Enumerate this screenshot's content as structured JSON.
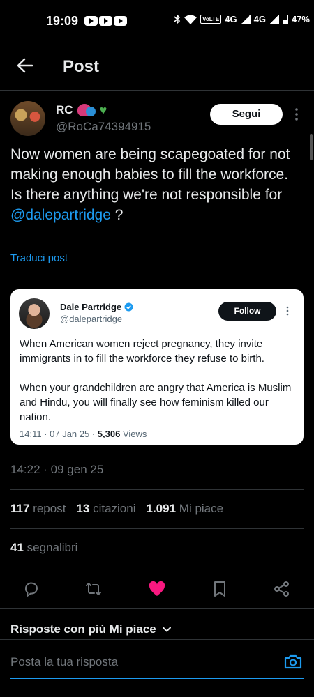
{
  "status_bar": {
    "time": "19:09",
    "network": "4G",
    "network2": "4G",
    "volte": "VoLTE",
    "battery": "47%"
  },
  "header": {
    "title": "Post"
  },
  "post": {
    "author_name": "RC",
    "author_handle": "@RoCa74394915",
    "follow_label": "Segui",
    "text_line1": "Now women are being scapegoated for not making enough babies to fill the workforce.",
    "text_line2": "Is there anything we're not responsible for",
    "mention": "@dalepartridge",
    "text_end": " ?",
    "translate_label": "Traduci post",
    "timestamp": "14:22 · 09 gen 25"
  },
  "quote": {
    "author_name": "Dale Partridge",
    "author_handle": "@dalepartridge",
    "follow_label": "Follow",
    "para1": "When American women reject pregnancy, they invite immigrants in to fill the workforce they refuse to birth.",
    "para2": "When your grandchildren are angry that America is Muslim and Hindu, you will finally see how feminism killed our nation.",
    "meta_time": "14:11 · 07 Jan 25 · ",
    "views_count": "5,306",
    "views_label": " Views"
  },
  "stats": {
    "reposts_count": "117",
    "reposts_label": "repost",
    "quotes_count": "13",
    "quotes_label": "citazioni",
    "likes_count": "1.091",
    "likes_label": "Mi piace",
    "bookmarks_count": "41",
    "bookmarks_label": "segnalibri"
  },
  "replies": {
    "sort_label": "Risposte con più Mi piace",
    "placeholder": "Posta la tua risposta"
  },
  "colors": {
    "accent": "#1d9bf0",
    "like": "#f91880",
    "background": "#000000"
  },
  "icons": [
    "back-arrow-icon",
    "more-icon",
    "verified-icon",
    "reply-icon",
    "repost-icon",
    "heart-icon",
    "bookmark-icon",
    "share-icon",
    "chevron-down-icon",
    "camera-icon"
  ]
}
